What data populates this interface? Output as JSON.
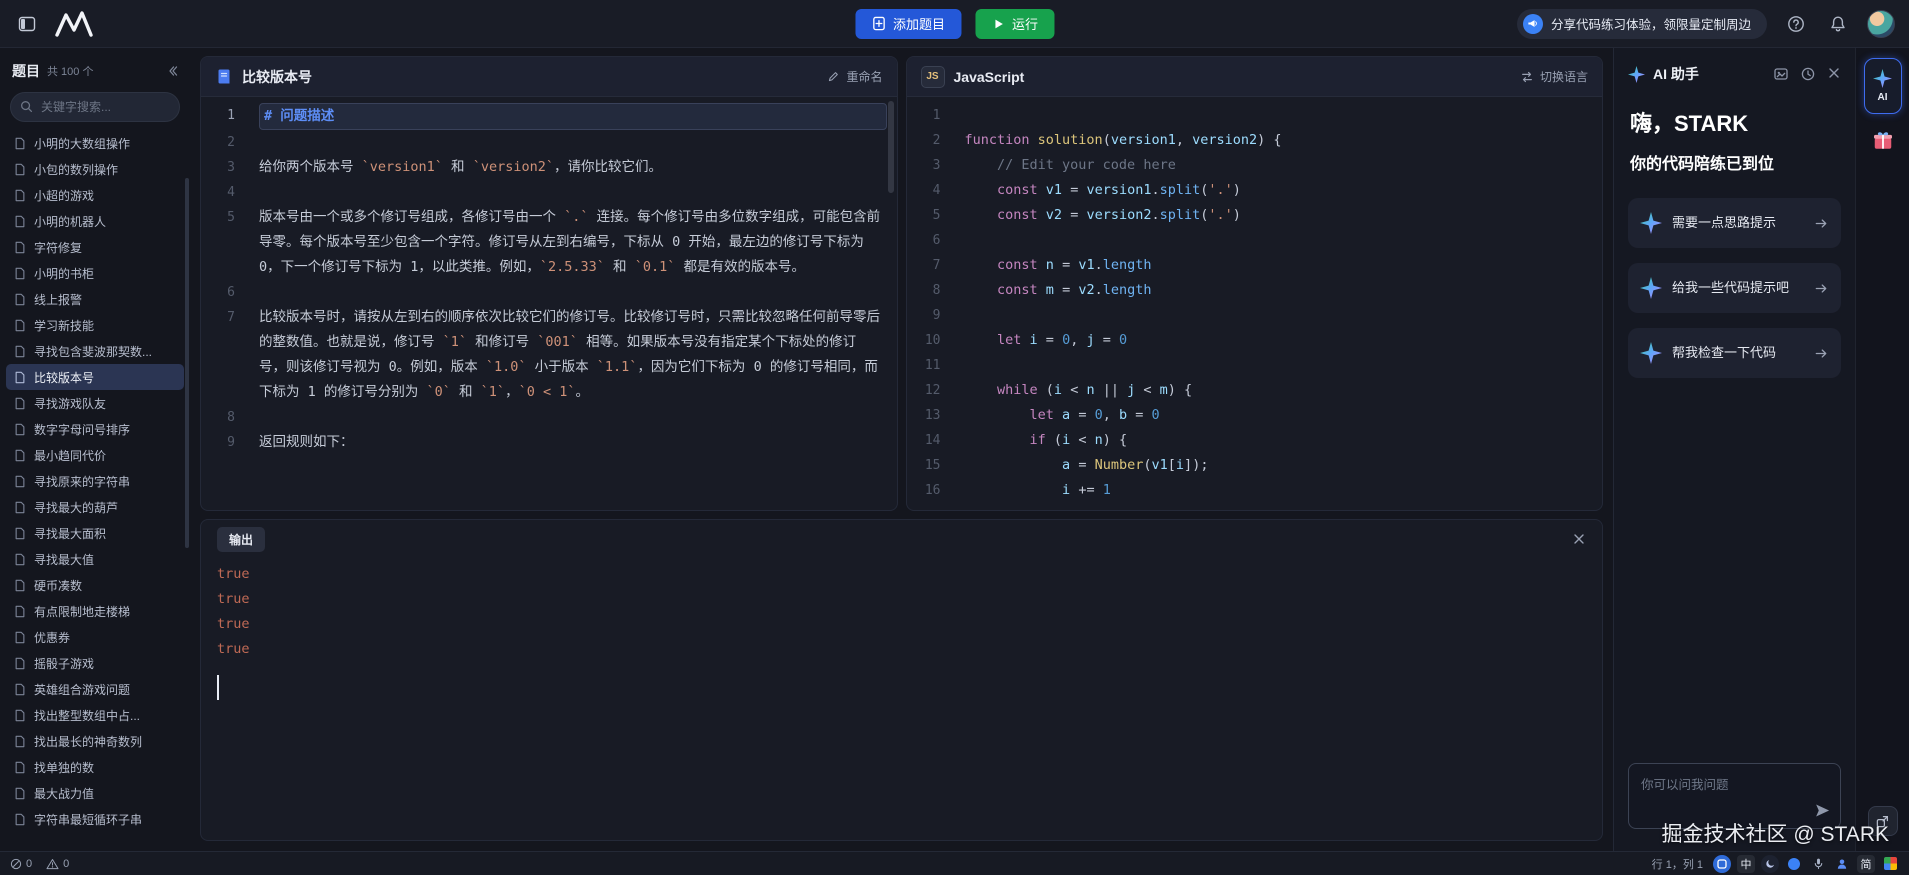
{
  "topbar": {
    "add_button": "添加题目",
    "run_button": "运行",
    "promo": "分享代码练习体验，领限量定制周边"
  },
  "sidebar": {
    "title": "题目",
    "count": "共 100 个",
    "search_placeholder": "关键字搜索...",
    "items": [
      {
        "label": "小明的大数组操作",
        "active": false
      },
      {
        "label": "小包的数列操作",
        "active": false
      },
      {
        "label": "小超的游戏",
        "active": false
      },
      {
        "label": "小明的机器人",
        "active": false
      },
      {
        "label": "字符修复",
        "active": false
      },
      {
        "label": "小明的书柜",
        "active": false
      },
      {
        "label": "线上报警",
        "active": false
      },
      {
        "label": "学习新技能",
        "active": false
      },
      {
        "label": "寻找包含斐波那契数...",
        "active": false
      },
      {
        "label": "比较版本号",
        "active": true
      },
      {
        "label": "寻找游戏队友",
        "active": false
      },
      {
        "label": "数字字母问号排序",
        "active": false
      },
      {
        "label": "最小趋同代价",
        "active": false
      },
      {
        "label": "寻找原来的字符串",
        "active": false
      },
      {
        "label": "寻找最大的葫芦",
        "active": false
      },
      {
        "label": "寻找最大面积",
        "active": false
      },
      {
        "label": "寻找最大值",
        "active": false
      },
      {
        "label": "硬币凑数",
        "active": false
      },
      {
        "label": "有点限制地走楼梯",
        "active": false
      },
      {
        "label": "优惠券",
        "active": false
      },
      {
        "label": "摇骰子游戏",
        "active": false
      },
      {
        "label": "英雄组合游戏问题",
        "active": false
      },
      {
        "label": "找出整型数组中占...",
        "active": false
      },
      {
        "label": "找出最长的神奇数列",
        "active": false
      },
      {
        "label": "找单独的数",
        "active": false
      },
      {
        "label": "最大战力值",
        "active": false
      },
      {
        "label": "字符串最短循环子串",
        "active": false
      }
    ]
  },
  "problem": {
    "title": "比较版本号",
    "rename_label": "重命名",
    "lines": [
      {
        "num": 1,
        "current": true,
        "segments": [
          [
            "# 问题描述",
            "h"
          ]
        ]
      },
      {
        "num": 2,
        "segments": []
      },
      {
        "num": 3,
        "segments": [
          [
            "给你两个版本号 ",
            ""
          ],
          [
            "`version1`",
            "code"
          ],
          [
            " 和 ",
            ""
          ],
          [
            "`version2`",
            "code"
          ],
          [
            "，请你比较它们。",
            ""
          ]
        ]
      },
      {
        "num": 4,
        "segments": []
      },
      {
        "num": 5,
        "segments": [
          [
            "版本号由一个或多个修订号组成，各修订号由一个 ",
            ""
          ],
          [
            "`.`",
            "code"
          ],
          [
            " 连接。每个修订号由多位数字组成，可能包含前导零。每个版本号至少包含一个字符。修订号从左到右编号，下标从 0 开始，最左边的修订号下标为 0，下一个修订号下标为 1，以此类推。例如，",
            ""
          ],
          [
            "`2.5.33`",
            "code"
          ],
          [
            " 和 ",
            ""
          ],
          [
            "`0.1`",
            "code"
          ],
          [
            " 都是有效的版本号。",
            ""
          ]
        ]
      },
      {
        "num": 6,
        "segments": []
      },
      {
        "num": 7,
        "segments": [
          [
            "比较版本号时，请按从左到右的顺序依次比较它们的修订号。比较修订号时，只需比较忽略任何前导零后的整数值。也就是说，修订号 ",
            ""
          ],
          [
            "`1`",
            "code"
          ],
          [
            " 和修订号 ",
            ""
          ],
          [
            "`001`",
            "code"
          ],
          [
            " 相等。如果版本号没有指定某个下标处的修订号，则该修订号视为 0。例如，版本 ",
            ""
          ],
          [
            "`1.0`",
            "code"
          ],
          [
            " 小于版本 ",
            ""
          ],
          [
            "`1.1`",
            "code"
          ],
          [
            "，因为它们下标为 0 的修订号相同，而下标为 1 的修订号分别为 ",
            ""
          ],
          [
            "`0`",
            "code"
          ],
          [
            " 和 ",
            ""
          ],
          [
            "`1`",
            "code"
          ],
          [
            "，",
            ""
          ],
          [
            "`0 < 1`",
            "code"
          ],
          [
            "。",
            ""
          ]
        ]
      },
      {
        "num": 8,
        "segments": []
      },
      {
        "num": 9,
        "segments": [
          [
            "返回规则如下：",
            ""
          ]
        ]
      }
    ]
  },
  "editor": {
    "badge": "JS",
    "language": "JavaScript",
    "switch_label": "切换语言",
    "lines": [
      {
        "num": 1,
        "tokens": []
      },
      {
        "num": 2,
        "tokens": [
          [
            "function ",
            "kw"
          ],
          [
            "solution",
            "fn"
          ],
          [
            "(",
            ""
          ],
          [
            "version1",
            "var"
          ],
          [
            ", ",
            ""
          ],
          [
            "version2",
            "var"
          ],
          [
            ") {",
            ""
          ]
        ]
      },
      {
        "num": 3,
        "tokens": [
          [
            "    ",
            ""
          ],
          [
            "// Edit your code here",
            "cmt"
          ]
        ]
      },
      {
        "num": 4,
        "tokens": [
          [
            "    ",
            ""
          ],
          [
            "const ",
            "kw"
          ],
          [
            "v1",
            "var"
          ],
          [
            " = ",
            ""
          ],
          [
            "version1",
            "var"
          ],
          [
            ".",
            ""
          ],
          [
            "split",
            "mth"
          ],
          [
            "(",
            ""
          ],
          [
            "'.'",
            "str"
          ],
          [
            ")",
            ""
          ]
        ]
      },
      {
        "num": 5,
        "tokens": [
          [
            "    ",
            ""
          ],
          [
            "const ",
            "kw"
          ],
          [
            "v2",
            "var"
          ],
          [
            " = ",
            ""
          ],
          [
            "version2",
            "var"
          ],
          [
            ".",
            ""
          ],
          [
            "split",
            "mth"
          ],
          [
            "(",
            ""
          ],
          [
            "'.'",
            "str"
          ],
          [
            ")",
            ""
          ]
        ]
      },
      {
        "num": 6,
        "tokens": []
      },
      {
        "num": 7,
        "tokens": [
          [
            "    ",
            ""
          ],
          [
            "const ",
            "kw"
          ],
          [
            "n",
            "var"
          ],
          [
            " = ",
            ""
          ],
          [
            "v1",
            "var"
          ],
          [
            ".",
            ""
          ],
          [
            "length",
            "mth"
          ]
        ]
      },
      {
        "num": 8,
        "tokens": [
          [
            "    ",
            ""
          ],
          [
            "const ",
            "kw"
          ],
          [
            "m",
            "var"
          ],
          [
            " = ",
            ""
          ],
          [
            "v2",
            "var"
          ],
          [
            ".",
            ""
          ],
          [
            "length",
            "mth"
          ]
        ]
      },
      {
        "num": 9,
        "tokens": []
      },
      {
        "num": 10,
        "tokens": [
          [
            "    ",
            ""
          ],
          [
            "let ",
            "kw"
          ],
          [
            "i",
            "var"
          ],
          [
            " = ",
            ""
          ],
          [
            "0",
            "num"
          ],
          [
            ", ",
            ""
          ],
          [
            "j",
            "var"
          ],
          [
            " = ",
            ""
          ],
          [
            "0",
            "num"
          ]
        ]
      },
      {
        "num": 11,
        "tokens": []
      },
      {
        "num": 12,
        "tokens": [
          [
            "    ",
            ""
          ],
          [
            "while",
            "kw"
          ],
          [
            " (",
            ""
          ],
          [
            "i",
            "var"
          ],
          [
            " < ",
            ""
          ],
          [
            "n",
            "var"
          ],
          [
            " || ",
            ""
          ],
          [
            "j",
            "var"
          ],
          [
            " < ",
            ""
          ],
          [
            "m",
            "var"
          ],
          [
            ") {",
            ""
          ]
        ]
      },
      {
        "num": 13,
        "tokens": [
          [
            "        ",
            ""
          ],
          [
            "let ",
            "kw"
          ],
          [
            "a",
            "var"
          ],
          [
            " = ",
            ""
          ],
          [
            "0",
            "num"
          ],
          [
            ", ",
            ""
          ],
          [
            "b",
            "var"
          ],
          [
            " = ",
            ""
          ],
          [
            "0",
            "num"
          ]
        ]
      },
      {
        "num": 14,
        "tokens": [
          [
            "        ",
            ""
          ],
          [
            "if",
            "kw"
          ],
          [
            " (",
            ""
          ],
          [
            "i",
            "var"
          ],
          [
            " < ",
            ""
          ],
          [
            "n",
            "var"
          ],
          [
            ") {",
            ""
          ]
        ]
      },
      {
        "num": 15,
        "tokens": [
          [
            "            ",
            ""
          ],
          [
            "a",
            "var"
          ],
          [
            " = ",
            ""
          ],
          [
            "Number",
            "fn"
          ],
          [
            "(",
            ""
          ],
          [
            "v1",
            "var"
          ],
          [
            "[",
            ""
          ],
          [
            "i",
            "var"
          ],
          [
            "]",
            ""
          ],
          [
            ");",
            ""
          ]
        ]
      },
      {
        "num": 16,
        "tokens": [
          [
            "            ",
            ""
          ],
          [
            "i",
            "var"
          ],
          [
            " += ",
            ""
          ],
          [
            "1",
            "num"
          ]
        ]
      }
    ]
  },
  "output": {
    "title": "输出",
    "lines": [
      "true",
      "true",
      "true",
      "true"
    ]
  },
  "ai": {
    "title": "AI 助手",
    "greeting": "嗨，STARK",
    "subtitle": "你的代码陪练已到位",
    "cards": [
      {
        "label": "需要一点思路提示"
      },
      {
        "label": "给我一些代码提示吧"
      },
      {
        "label": "帮我检查一下代码"
      }
    ],
    "input_placeholder": "你可以问我问题",
    "rail_label": "AI"
  },
  "statusbar": {
    "errors": "0",
    "warnings": "0",
    "cursor_position": "行 1，列 1",
    "ime_cn": "中",
    "ime_jian": "简"
  },
  "watermark": "掘金技术社区 @ STARK",
  "colors": {
    "accent_blue": "#2458d8",
    "run_green": "#17a24d",
    "active_item": "#2b3553",
    "output_value": "#c06a55",
    "heading_blue": "#5d8df5"
  }
}
